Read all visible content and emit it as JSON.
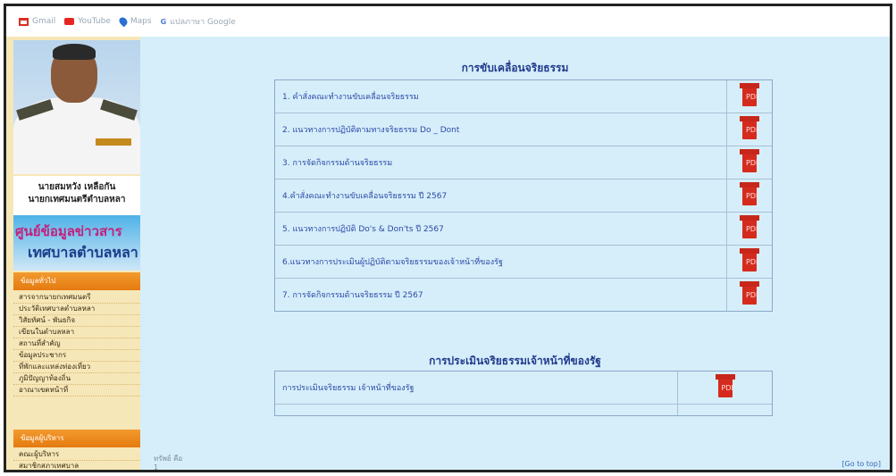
{
  "bookmarks": [
    {
      "label": "Gmail",
      "icon": "gmail-icon"
    },
    {
      "label": "YouTube",
      "icon": "youtube-icon"
    },
    {
      "label": "Maps",
      "icon": "maps-icon"
    },
    {
      "label": "แปลภาษา Google",
      "icon": "translate-icon"
    }
  ],
  "sidebar": {
    "name_line1": "นายสมหวัง เหลือกัน",
    "name_line2": "นายกเทศมนตรีตำบลหลา",
    "banner_line1": "ศูนย์ข้อมูลข่าวสาร",
    "banner_line2": "เทศบาลตำบลหลา",
    "menu1_title": "ข้อมูลทั่วไป",
    "menu1_items": [
      "สารจากนายกเทศมนตรี",
      "ประวัติเทศบาลตำบลหลา",
      "วิสัยทัศน์ - พันธกิจ",
      "เขียนในตำบลหลา",
      "สถานที่สำคัญ",
      "ข้อมูลประชากร",
      "ที่พักและแหล่งท่องเที่ยว",
      "ภูมิปัญญาท้องถิ่น",
      "อาณาเขตหน้าที่"
    ],
    "menu2_title": "ข้อมูลผู้บริหาร",
    "menu2_items": [
      "คณะผู้บริหาร",
      "สมาชิกสภาเทศบาล"
    ]
  },
  "section1": {
    "title": "การขับเคลื่อนจริยธรรม",
    "rows": [
      "1. คำสั่งคณะทำงานขับเคลื่อนจริยธรรม",
      "2. แนวทางการปฏิบัติตามทางจริยธรรม Do _ Dont",
      "3. การจัดกิจกรรมด้านจริยธรรม",
      "4.คำสั่งคณะทำงานขับเคลื่อนจริยธรรม ปี 2567",
      "5. แนวทางการปฏิบัติ Do's & Don'ts ปี 2567",
      "6.แนวทางการประเมินผู้ปฏิบัติตามจริยธรรมของเจ้าหน้าที่ของรัฐ",
      "7. การจัดกิจกรรมด้านจริยธรรม ปี 2567"
    ]
  },
  "section2": {
    "title": "การประเมินจริยธรรมเจ้าหน้าที่ของรัฐ",
    "rows": [
      "การประเมินจริยธรรม เจ้าหน้าที่ของรัฐ"
    ]
  },
  "pdf_icon_text": "PDF",
  "footer": {
    "left_line1": "ทรัพย์ คือ",
    "left_line2": "1",
    "right": "[Go to top]"
  },
  "colors": {
    "accent": "#213a8c",
    "background": "#d6eefa",
    "menu_header": "#e57a10",
    "pdf": "#d52b1e"
  }
}
